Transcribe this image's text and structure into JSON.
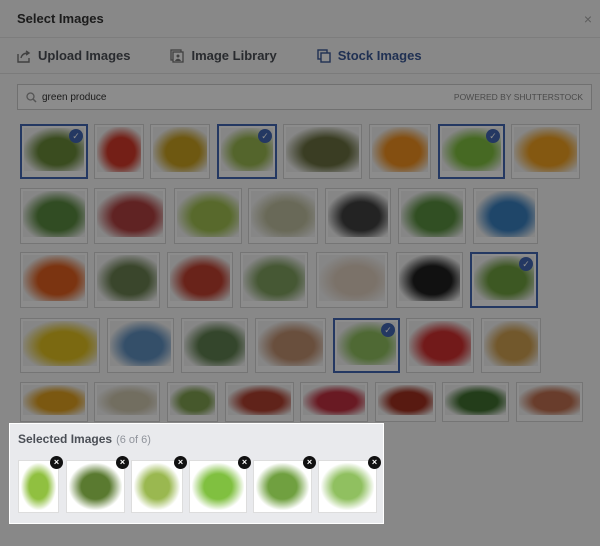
{
  "dialog": {
    "title": "Select Images",
    "close_label": "×"
  },
  "tabs": [
    {
      "label": "Upload Images",
      "icon": "upload-icon",
      "active": false
    },
    {
      "label": "Image Library",
      "icon": "library-icon",
      "active": false
    },
    {
      "label": "Stock Images",
      "icon": "stock-icon",
      "active": true
    }
  ],
  "search": {
    "value": "green produce",
    "powered_by": "POWERED BY SHUTTERSTOCK"
  },
  "accent": "#4267b2",
  "results": [
    [
      {
        "name": "avocado",
        "color": "#6a8a3a",
        "selected": true
      },
      {
        "name": "tomatoes",
        "color": "#d33a2a"
      },
      {
        "name": "vegetables",
        "color": "#c8a020"
      },
      {
        "name": "custard-apple",
        "color": "#9ab850",
        "selected": true
      },
      {
        "name": "squash",
        "color": "#6a7040"
      },
      {
        "name": "citrus",
        "color": "#f09020"
      },
      {
        "name": "green-apples-crate",
        "color": "#80c040",
        "selected": true
      },
      {
        "name": "orange",
        "color": "#f0a020"
      }
    ],
    [
      {
        "name": "lettuce-field",
        "color": "#5a8a40"
      },
      {
        "name": "vegetable-pile",
        "color": "#b04040"
      },
      {
        "name": "eggs-grass",
        "color": "#a0c050"
      },
      {
        "name": "berries-boxes",
        "color": "#c0c0a0"
      },
      {
        "name": "eggplant",
        "color": "#404040"
      },
      {
        "name": "tea-field",
        "color": "#5a9040"
      },
      {
        "name": "statue-sky",
        "color": "#3a80c0"
      }
    ],
    [
      {
        "name": "apples-oranges",
        "color": "#e06020"
      },
      {
        "name": "kale",
        "color": "#6a8050"
      },
      {
        "name": "apples-bowl",
        "color": "#c04030"
      },
      {
        "name": "cucumbers",
        "color": "#80a060"
      },
      {
        "name": "peppers",
        "color": "#e0d0c0"
      },
      {
        "name": "book",
        "color": "#202020"
      },
      {
        "name": "custard-apple-tree",
        "color": "#70a040",
        "selected": true
      }
    ],
    [
      {
        "name": "yellow-flowers",
        "color": "#e0c020"
      },
      {
        "name": "farmhouse",
        "color": "#6090c0"
      },
      {
        "name": "crop-field",
        "color": "#608050"
      },
      {
        "name": "tomato-fork",
        "color": "#c09070"
      },
      {
        "name": "lettuce",
        "color": "#90c060",
        "selected": true
      },
      {
        "name": "strawberries",
        "color": "#d03030"
      },
      {
        "name": "grain-bowl",
        "color": "#d0a050"
      }
    ],
    [
      {
        "name": "bitter-melon",
        "color": "#e0a020"
      },
      {
        "name": "garlic",
        "color": "#d0c8b0"
      },
      {
        "name": "artichoke",
        "color": "#80a050"
      },
      {
        "name": "chilies",
        "color": "#b04030"
      },
      {
        "name": "radishes",
        "color": "#c03040"
      },
      {
        "name": "tomato-vines",
        "color": "#a03020"
      },
      {
        "name": "herbs",
        "color": "#407030"
      },
      {
        "name": "market",
        "color": "#c07050"
      }
    ]
  ],
  "selected": {
    "title": "Selected Images",
    "count": "(6 of 6)",
    "items": [
      {
        "name": "green-apple",
        "color": "#90c040"
      },
      {
        "name": "avocado",
        "color": "#5a7a30"
      },
      {
        "name": "custard-apple",
        "color": "#9ab850"
      },
      {
        "name": "green-apples-crate",
        "color": "#80c040"
      },
      {
        "name": "custard-apple-tree",
        "color": "#70a040"
      },
      {
        "name": "lettuce",
        "color": "#90c060"
      }
    ],
    "remove_label": "×"
  }
}
